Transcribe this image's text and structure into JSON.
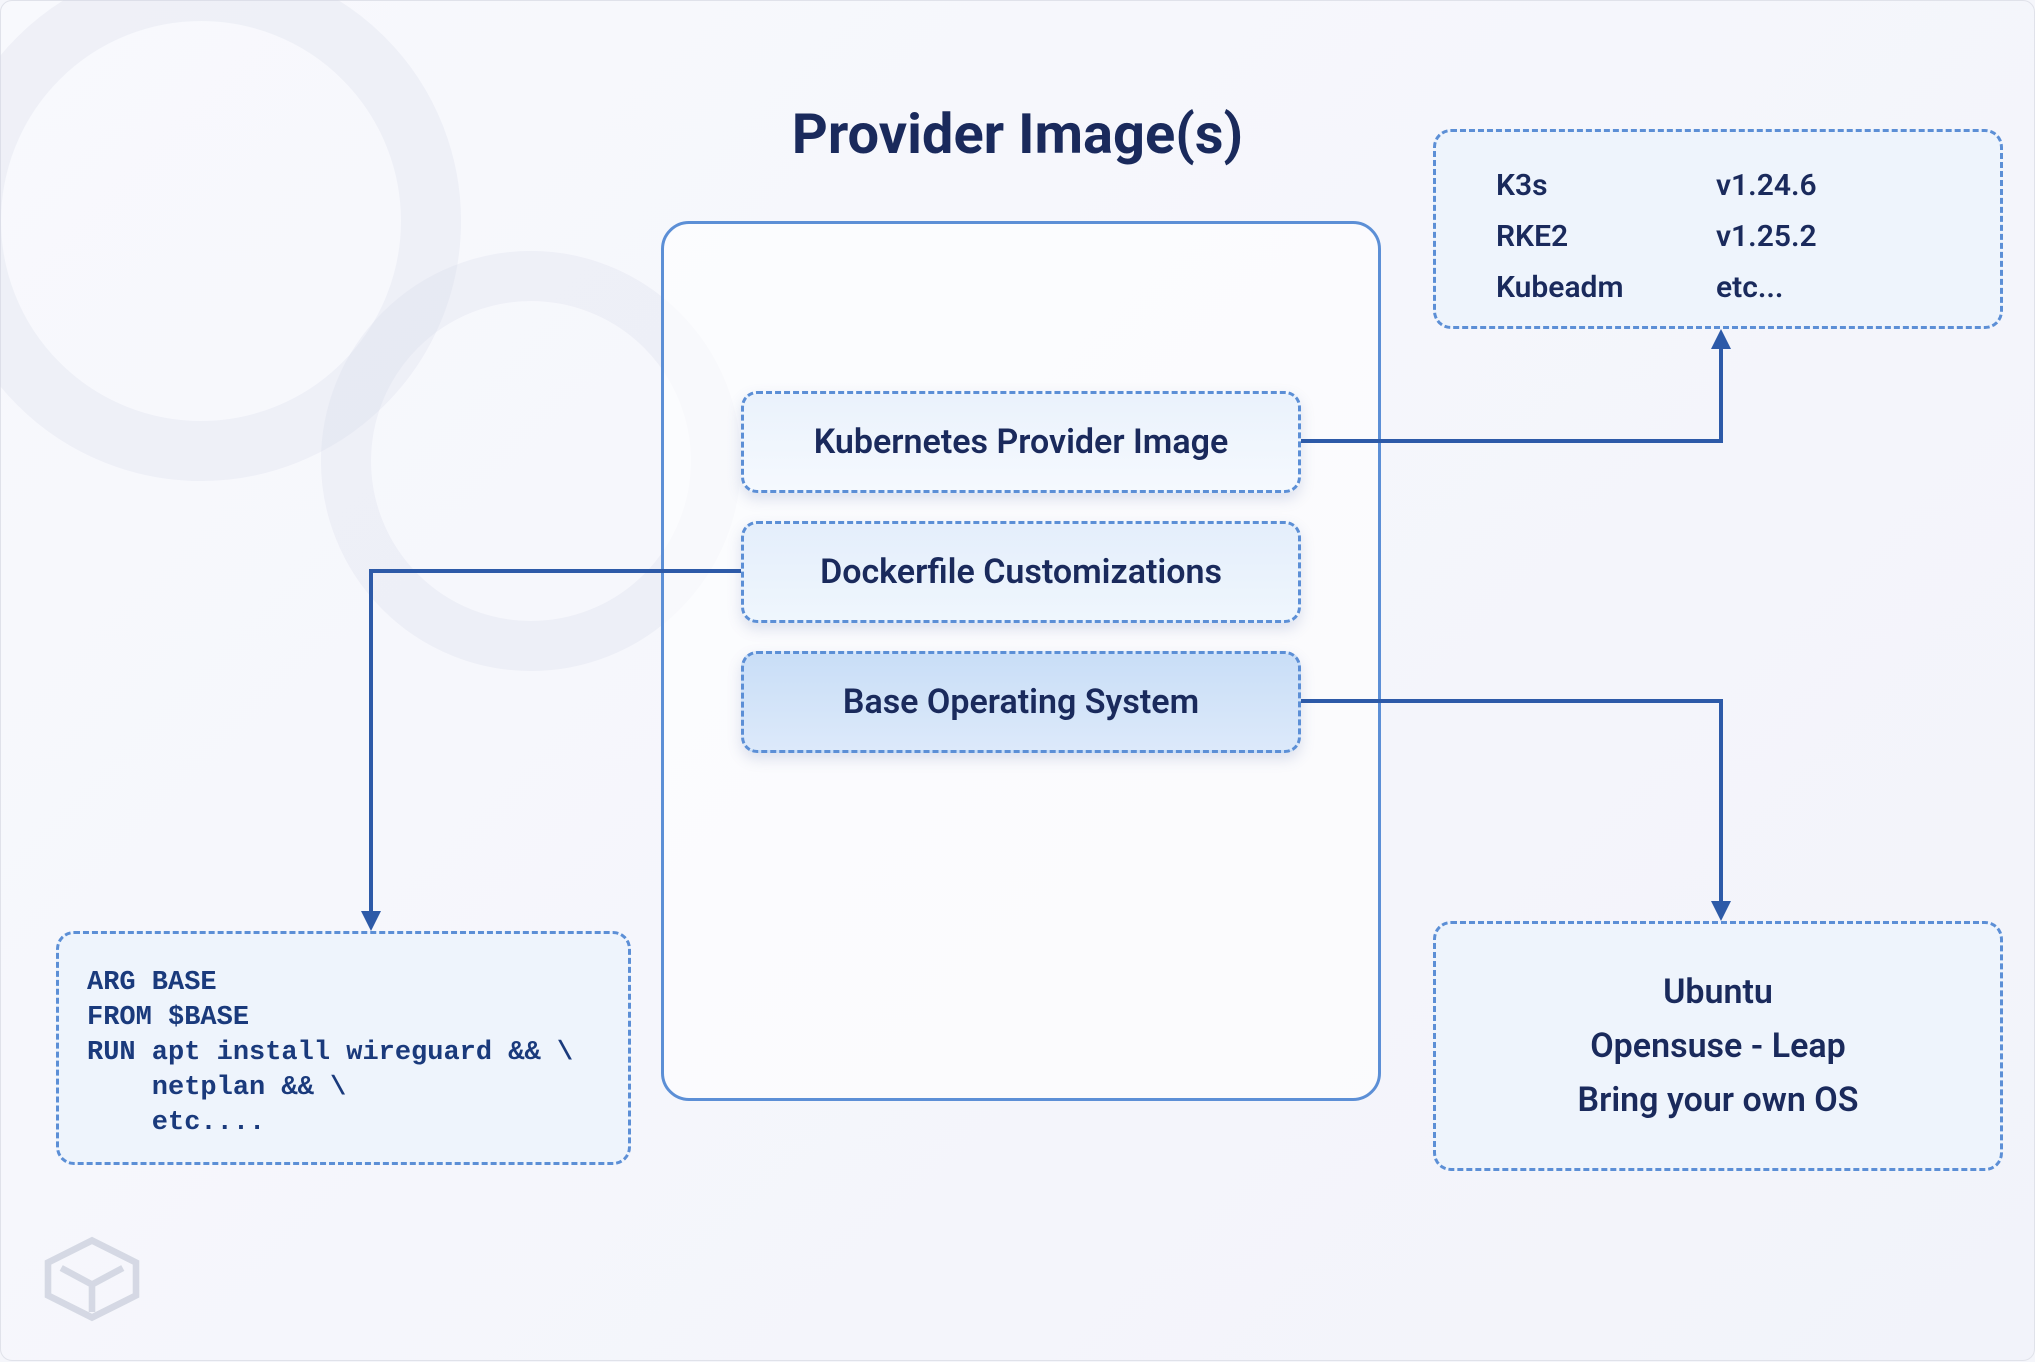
{
  "title": "Provider Image(s)",
  "layers": {
    "k8s": "Kubernetes Provider Image",
    "docker": "Dockerfile Customizations",
    "baseos": "Base Operating System"
  },
  "k8s_distros": [
    {
      "name": "K3s",
      "version": "v1.24.6"
    },
    {
      "name": "RKE2",
      "version": "v1.25.2"
    },
    {
      "name": "Kubeadm",
      "version": "etc..."
    }
  ],
  "os_options": [
    "Ubuntu",
    "Opensuse - Leap",
    "Bring your own OS"
  ],
  "dockerfile_code": "ARG BASE\nFROM $BASE\nRUN apt install wireguard && \\\n    netplan && \\\n    etc...."
}
